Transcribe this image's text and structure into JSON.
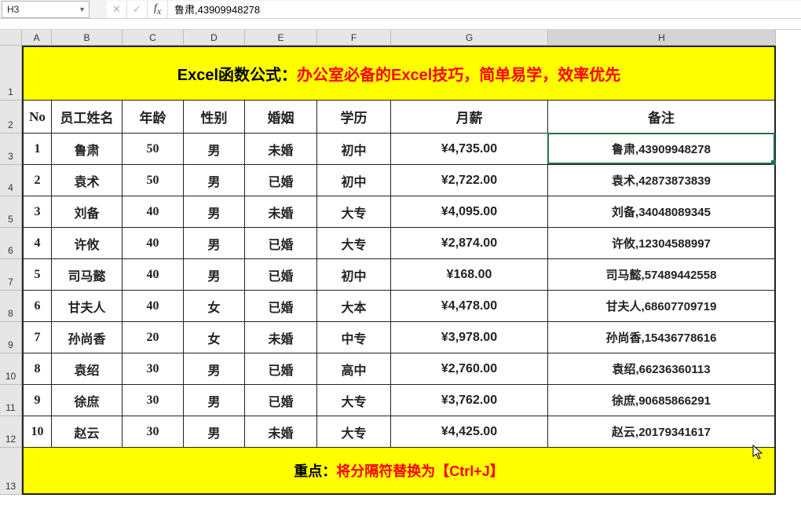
{
  "formula_bar": {
    "name_box": "H3",
    "formula": "鲁肃,43909948278"
  },
  "columns": [
    "A",
    "B",
    "C",
    "D",
    "E",
    "F",
    "G",
    "H"
  ],
  "row_numbers": [
    "1",
    "2",
    "3",
    "4",
    "5",
    "6",
    "7",
    "8",
    "9",
    "10",
    "11",
    "12",
    "13"
  ],
  "title": {
    "black": "Excel函数公式：",
    "red": "办公室必备的Excel技巧，简单易学，效率优先"
  },
  "headers": [
    "No",
    "员工姓名",
    "年龄",
    "性别",
    "婚姻",
    "学历",
    "月薪",
    "备注"
  ],
  "rows": [
    {
      "no": "1",
      "name": "鲁肃",
      "age": "50",
      "gender": "男",
      "marriage": "未婚",
      "edu": "初中",
      "salary": "¥4,735.00",
      "remark": "鲁肃,43909948278"
    },
    {
      "no": "2",
      "name": "袁术",
      "age": "50",
      "gender": "男",
      "marriage": "已婚",
      "edu": "初中",
      "salary": "¥2,722.00",
      "remark": "袁术,42873873839"
    },
    {
      "no": "3",
      "name": "刘备",
      "age": "40",
      "gender": "男",
      "marriage": "未婚",
      "edu": "大专",
      "salary": "¥4,095.00",
      "remark": "刘备,34048089345"
    },
    {
      "no": "4",
      "name": "许攸",
      "age": "40",
      "gender": "男",
      "marriage": "已婚",
      "edu": "大专",
      "salary": "¥2,874.00",
      "remark": "许攸,12304588997"
    },
    {
      "no": "5",
      "name": "司马懿",
      "age": "40",
      "gender": "男",
      "marriage": "已婚",
      "edu": "初中",
      "salary": "¥168.00",
      "remark": "司马懿,57489442558"
    },
    {
      "no": "6",
      "name": "甘夫人",
      "age": "40",
      "gender": "女",
      "marriage": "已婚",
      "edu": "大本",
      "salary": "¥4,478.00",
      "remark": "甘夫人,68607709719"
    },
    {
      "no": "7",
      "name": "孙尚香",
      "age": "20",
      "gender": "女",
      "marriage": "未婚",
      "edu": "中专",
      "salary": "¥3,978.00",
      "remark": "孙尚香,15436778616"
    },
    {
      "no": "8",
      "name": "袁绍",
      "age": "30",
      "gender": "男",
      "marriage": "已婚",
      "edu": "高中",
      "salary": "¥2,760.00",
      "remark": "袁绍,66236360113"
    },
    {
      "no": "9",
      "name": "徐庶",
      "age": "30",
      "gender": "男",
      "marriage": "已婚",
      "edu": "大专",
      "salary": "¥3,762.00",
      "remark": "徐庶,90685866291"
    },
    {
      "no": "10",
      "name": "赵云",
      "age": "30",
      "gender": "男",
      "marriage": "未婚",
      "edu": "大专",
      "salary": "¥4,425.00",
      "remark": "赵云,20179341617"
    }
  ],
  "footer": {
    "black": "重点：",
    "red": "将分隔符替换为【Ctrl+J】"
  },
  "active_cell": "H3"
}
